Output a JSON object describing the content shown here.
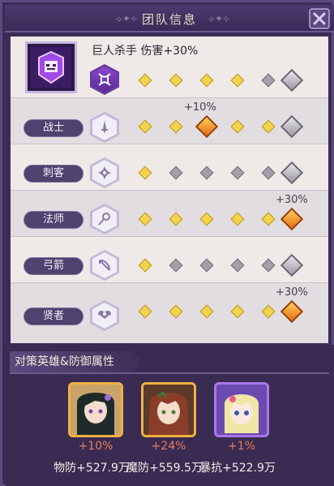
{
  "header": {
    "title": "团队信息",
    "ornament_left": "⟢✦⟣",
    "ornament_right": "⟢✦⟣"
  },
  "close_icon": "close-icon",
  "top_row": {
    "title": "巨人杀手  伤害+30%"
  },
  "classes": [
    {
      "label": "战士",
      "bonus": "+10%"
    },
    {
      "label": "刺客",
      "bonus": ""
    },
    {
      "label": "法师",
      "bonus": "+30%"
    },
    {
      "label": "弓箭",
      "bonus": ""
    },
    {
      "label": "贤者",
      "bonus": "+30%"
    }
  ],
  "diamond_rows": [
    {
      "small": [
        "y",
        "y",
        "y",
        "y",
        "g"
      ],
      "big": "g"
    },
    {
      "small": [
        "y",
        "y",
        "o",
        "y",
        "y"
      ],
      "big": "g"
    },
    {
      "small": [
        "y",
        "g",
        "g",
        "g",
        "g"
      ],
      "big": "g"
    },
    {
      "small": [
        "y",
        "y",
        "y",
        "y",
        "y"
      ],
      "big": "o"
    },
    {
      "small": [
        "y",
        "g",
        "g",
        "g",
        "g"
      ],
      "big": "g"
    },
    {
      "small": [
        "y",
        "y",
        "y",
        "y",
        "y"
      ],
      "big": "o"
    }
  ],
  "footer": {
    "tab_label": "对策英雄&防御属性",
    "heroes": [
      {
        "bonus": "+10%",
        "stat": "物防+527.9万"
      },
      {
        "bonus": "+24%",
        "stat": "魔防+559.5万"
      },
      {
        "bonus": "+1%",
        "stat": "暴抗+522.9万"
      }
    ]
  },
  "colors": {
    "accent_purple": "#6a3aa0",
    "gold_diamond": "#f4d34c",
    "orange_diamond": "#e46c14",
    "bonus_text": "#ea7a5a"
  }
}
